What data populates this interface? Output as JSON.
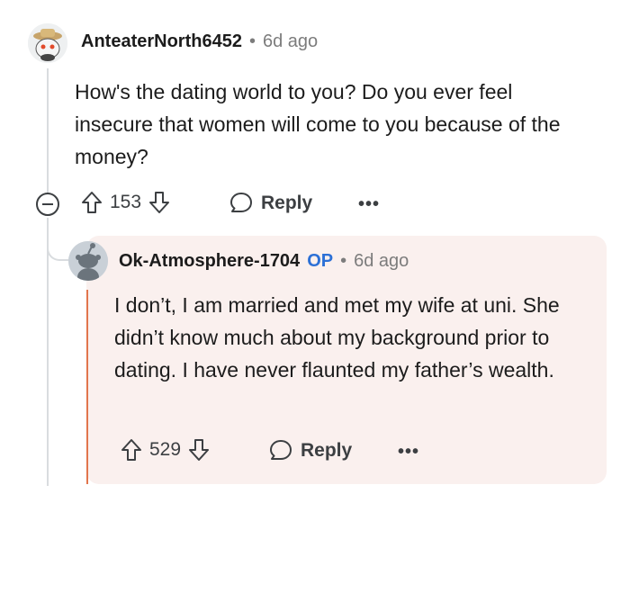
{
  "comment": {
    "username": "AnteaterNorth6452",
    "separator": "•",
    "time": "6d ago",
    "text": "How's the dating world to you? Do you ever feel insecure that women will come to you because of the money?",
    "upvotes": "153",
    "reply_label": "Reply",
    "more_label": "•••"
  },
  "reply": {
    "username": "Ok-Atmosphere-1704",
    "op_badge": "OP",
    "separator": "•",
    "time": "6d ago",
    "text": "I don’t, I am married and met my wife at uni. She didn’t know much about my background prior to dating. I have never flaunted my father’s wealth.",
    "upvotes": "529",
    "reply_label": "Reply",
    "more_label": "•••"
  },
  "colors": {
    "op_badge": "#2c70d6",
    "reply_accent": "#e2754d",
    "reply_background": "#faf0ee"
  }
}
